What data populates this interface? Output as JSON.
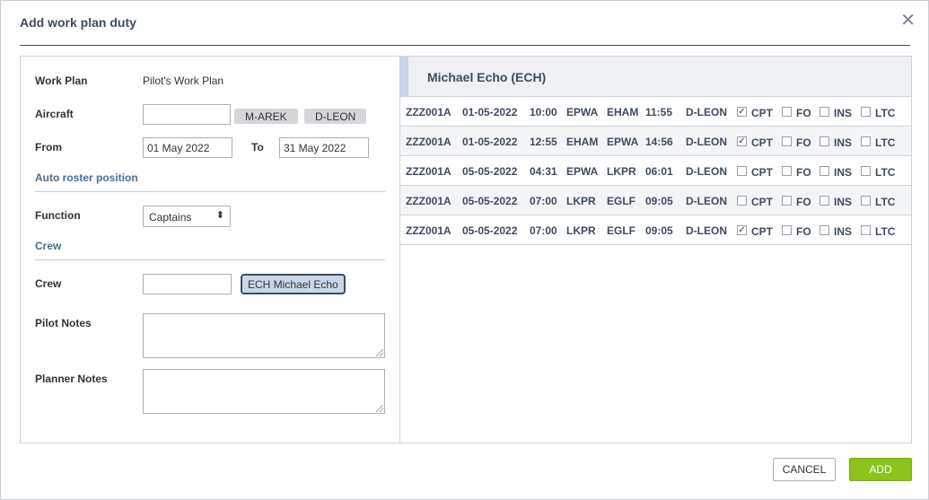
{
  "dialog": {
    "title": "Add work plan duty",
    "close_glyph": "✕"
  },
  "form": {
    "work_plan_label": "Work Plan",
    "work_plan_value": "Pilot's Work Plan",
    "aircraft_label": "Aircraft",
    "aircraft_value": "",
    "aircraft_tags": [
      "M-AREK",
      "D-LEON"
    ],
    "from_label": "From",
    "from_value": "01 May 2022",
    "to_label": "To",
    "to_value": "31 May 2022",
    "auto_roster_heading": "Auto roster position",
    "function_label": "Function",
    "function_value": "Captains",
    "crew_heading": "Crew",
    "crew_label": "Crew",
    "crew_value": "",
    "crew_tag": "ECH Michael Echo",
    "pilot_notes_label": "Pilot Notes",
    "planner_notes_label": "Planner Notes"
  },
  "pilot": {
    "name": "Michael Echo (ECH)"
  },
  "flights": [
    {
      "flight": "ZZZ001A",
      "date": "01-05-2022",
      "dep_time": "10:00",
      "from": "EPWA",
      "to": "EHAM",
      "arr_time": "11:55",
      "reg": "D-LEON",
      "cpt": true,
      "fo": false,
      "ins": false,
      "ltc": false
    },
    {
      "flight": "ZZZ001A",
      "date": "01-05-2022",
      "dep_time": "12:55",
      "from": "EHAM",
      "to": "EPWA",
      "arr_time": "14:56",
      "reg": "D-LEON",
      "cpt": true,
      "fo": false,
      "ins": false,
      "ltc": false
    },
    {
      "flight": "ZZZ001A",
      "date": "05-05-2022",
      "dep_time": "04:31",
      "from": "EPWA",
      "to": "LKPR",
      "arr_time": "06:01",
      "reg": "D-LEON",
      "cpt": false,
      "fo": false,
      "ins": false,
      "ltc": false
    },
    {
      "flight": "ZZZ001A",
      "date": "05-05-2022",
      "dep_time": "07:00",
      "from": "LKPR",
      "to": "EGLF",
      "arr_time": "09:05",
      "reg": "D-LEON",
      "cpt": false,
      "fo": false,
      "ins": false,
      "ltc": false
    },
    {
      "flight": "ZZZ001A",
      "date": "05-05-2022",
      "dep_time": "07:00",
      "from": "LKPR",
      "to": "EGLF",
      "arr_time": "09:05",
      "reg": "D-LEON",
      "cpt": true,
      "fo": false,
      "ins": false,
      "ltc": false
    }
  ],
  "role_labels": {
    "cpt": "CPT",
    "fo": "FO",
    "ins": "INS",
    "ltc": "LTC"
  },
  "buttons": {
    "cancel": "CANCEL",
    "add": "ADD"
  },
  "colors": {
    "accent_green": "#8cc21a",
    "title_text": "#3e4c5e",
    "section_text": "#4a6b8f"
  }
}
